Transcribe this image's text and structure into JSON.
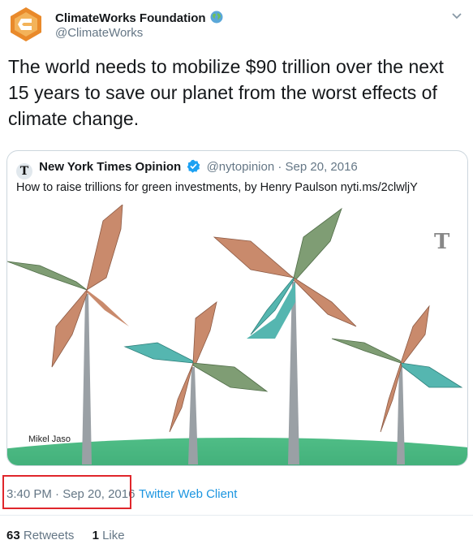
{
  "author": {
    "name": "ClimateWorks Foundation",
    "handle": "@ClimateWorks",
    "avatar_color": "#e98a2b"
  },
  "tweet": {
    "text": "The world needs to mobilize $90 trillion over the next 15 years to save our planet from the worst effects of climate change."
  },
  "quoted": {
    "name": "New York Times Opinion",
    "handle": "@nytopinion",
    "separator": " · ",
    "date": "Sep 20, 2016",
    "logo_glyph": "T",
    "text": "How to raise trillions for green investments, by Henry Paulson nyti.ms/2clwljY",
    "image": {
      "credit": "Mikel Jaso",
      "watermark": "T",
      "description_icon": "money-windmills-illustration"
    }
  },
  "meta": {
    "timestamp": "3:40 PM · Sep 20, 2016",
    "client": "Twitter Web Client"
  },
  "stats": {
    "retweets_count": "63",
    "retweets_label": "Retweets",
    "likes_count": "1",
    "likes_label": "Like"
  },
  "colors": {
    "link": "#1b95e0",
    "highlight": "#e0262b",
    "verified": "#1da1f2",
    "ground": "#3aa674"
  }
}
